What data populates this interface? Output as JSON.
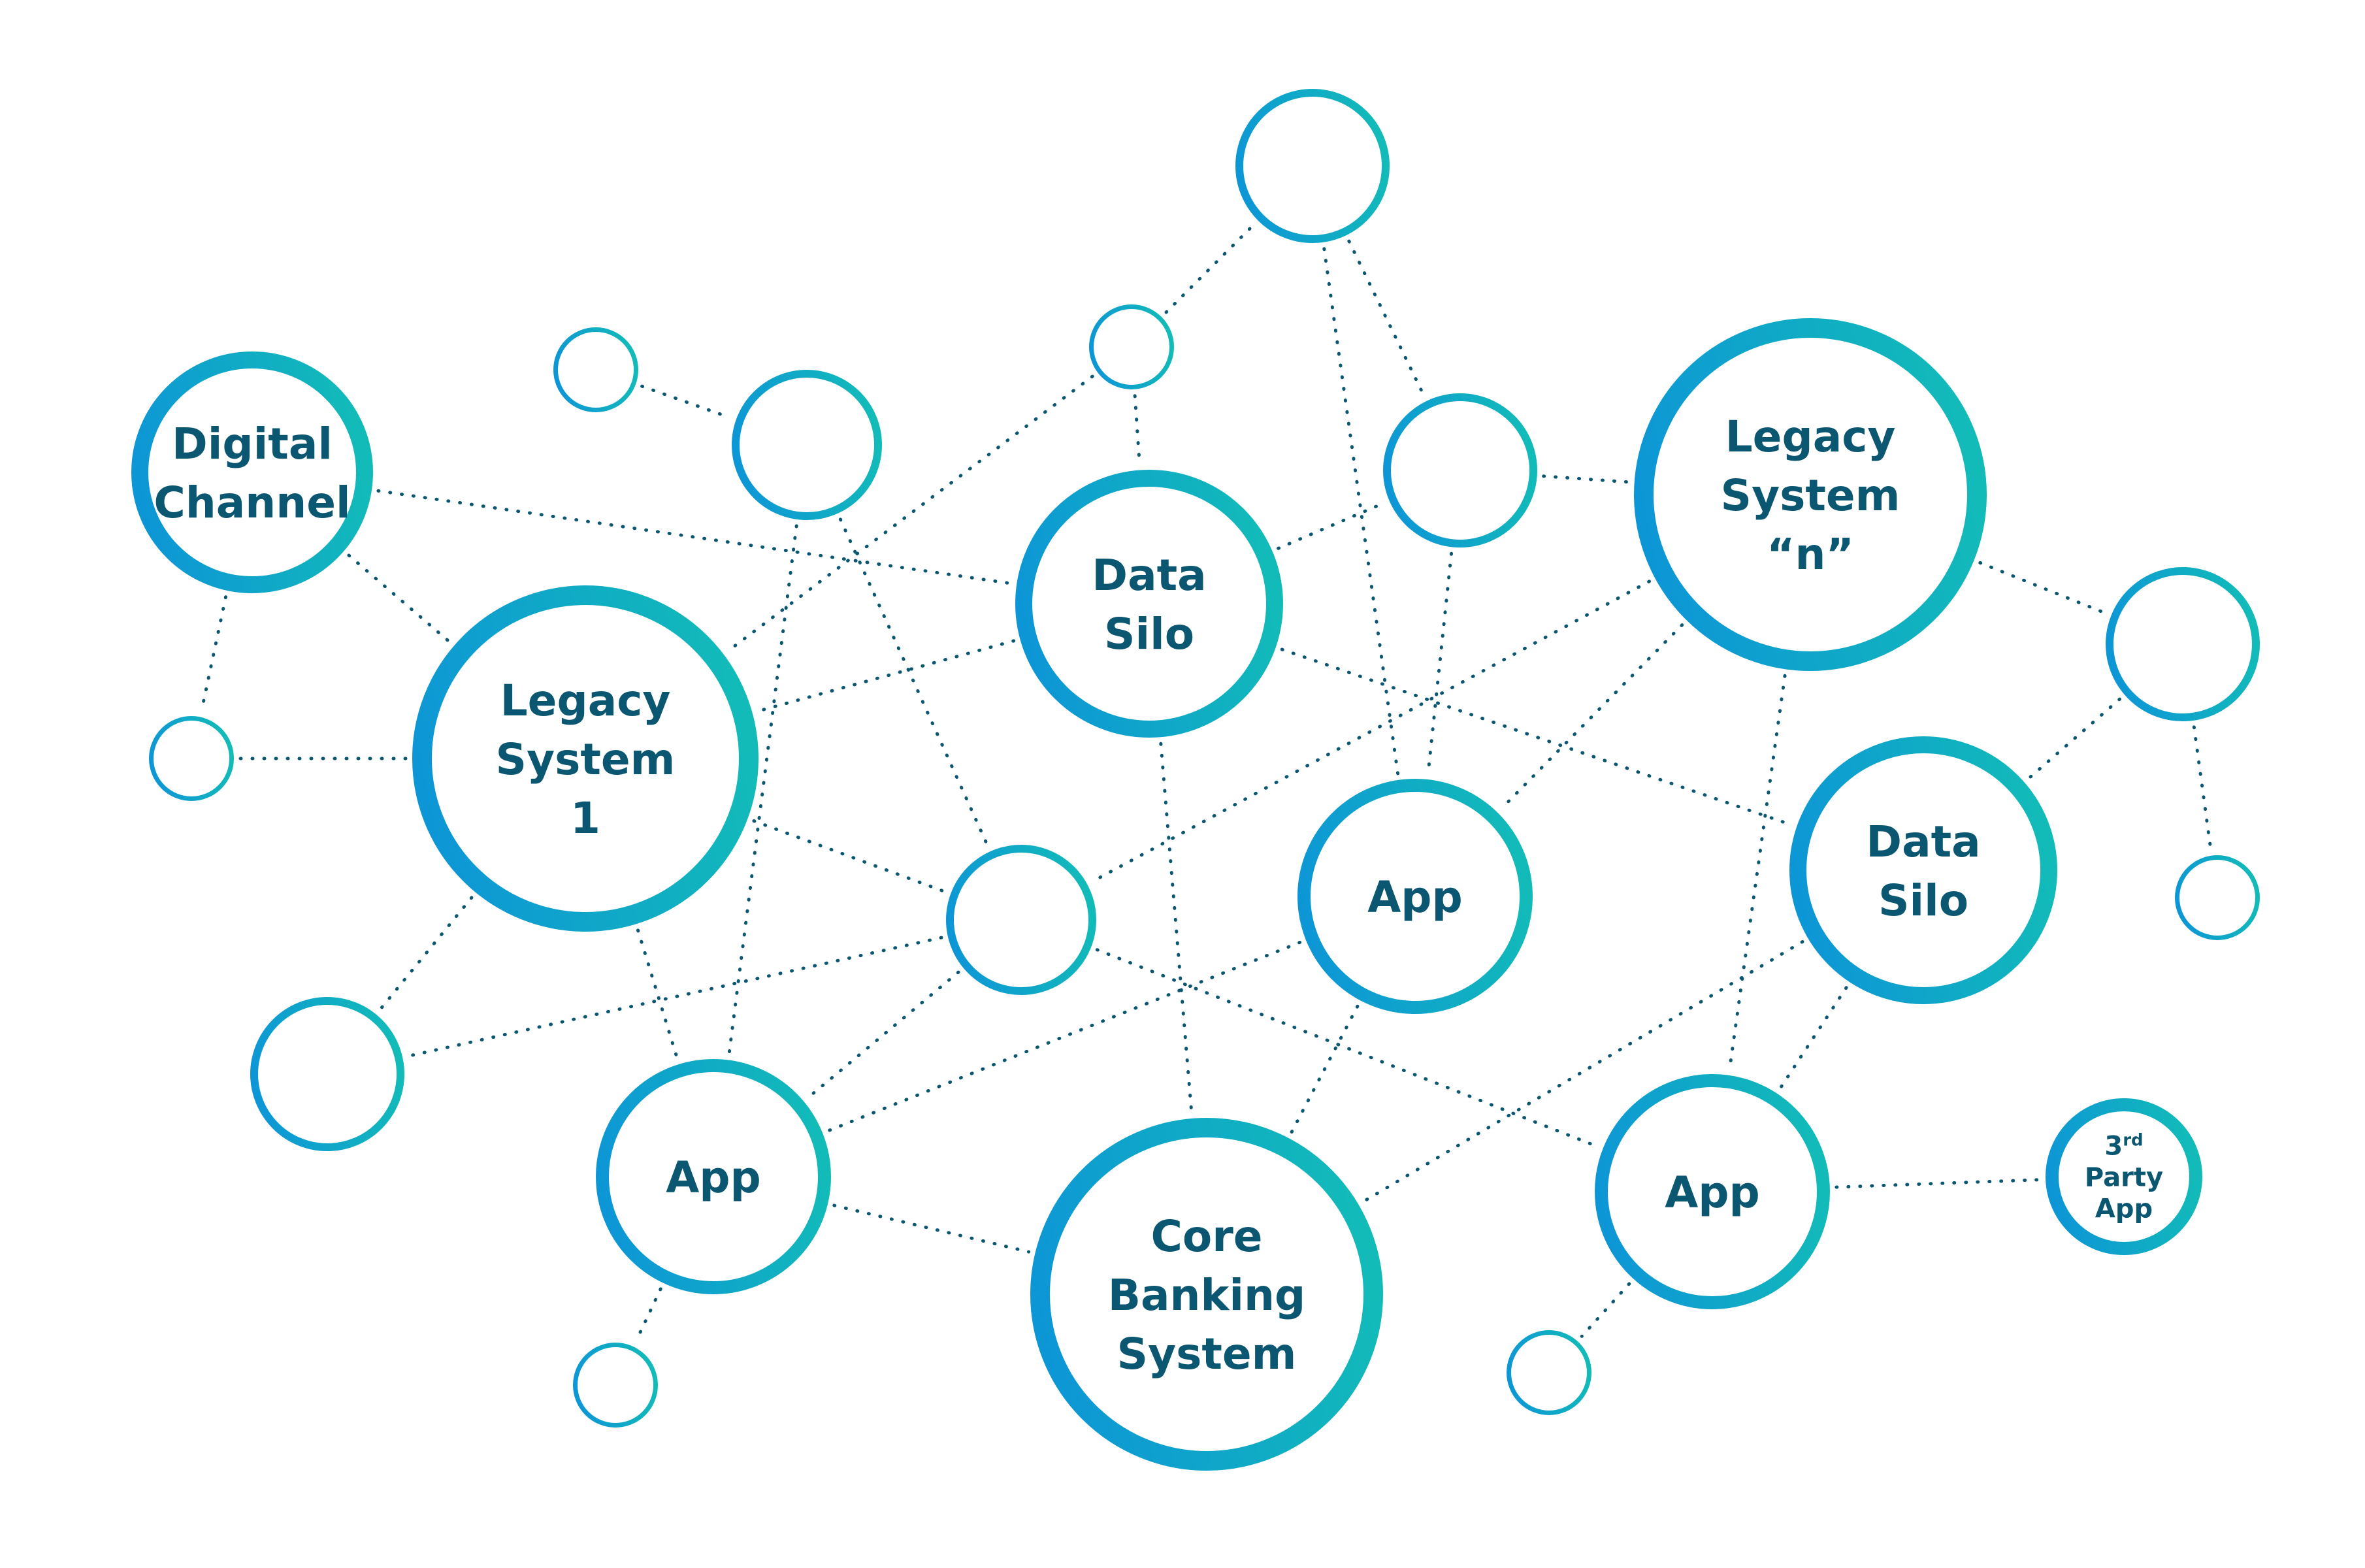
{
  "diagram": {
    "title": "",
    "colors": {
      "ring_start": "#0d96d6",
      "ring_end": "#12bbb8",
      "label": "#0b5670",
      "edge": "#0b5670",
      "background": "#ffffff"
    },
    "nodes": [
      {
        "id": "digital-channel",
        "label": [
          "Digital",
          "Channel"
        ],
        "size": "medium"
      },
      {
        "id": "empty-1",
        "label": [],
        "size": "tiny"
      },
      {
        "id": "empty-2",
        "label": [],
        "size": "small"
      },
      {
        "id": "empty-3",
        "label": [],
        "size": "tiny"
      },
      {
        "id": "empty-4",
        "label": [],
        "size": "small"
      },
      {
        "id": "data-silo-1",
        "label": [
          "Data",
          "Silo"
        ],
        "size": "medium"
      },
      {
        "id": "empty-5",
        "label": [],
        "size": "small"
      },
      {
        "id": "legacy-system-n",
        "label": [
          "Legacy",
          "System",
          "“n”"
        ],
        "size": "large"
      },
      {
        "id": "empty-6",
        "label": [],
        "size": "small"
      },
      {
        "id": "empty-7",
        "label": [],
        "size": "tiny"
      },
      {
        "id": "legacy-system-1",
        "label": [
          "Legacy",
          "System",
          "1"
        ],
        "size": "large"
      },
      {
        "id": "empty-8",
        "label": [],
        "size": "small"
      },
      {
        "id": "app-center",
        "label": [
          "App"
        ],
        "size": "medium"
      },
      {
        "id": "data-silo-2",
        "label": [
          "Data",
          "Silo"
        ],
        "size": "medium"
      },
      {
        "id": "empty-9",
        "label": [],
        "size": "tiny"
      },
      {
        "id": "empty-10",
        "label": [],
        "size": "small"
      },
      {
        "id": "app-left",
        "label": [
          "App"
        ],
        "size": "medium"
      },
      {
        "id": "core-banking-system",
        "label": [
          "Core",
          "Banking",
          "System"
        ],
        "size": "large"
      },
      {
        "id": "app-right",
        "label": [
          "App"
        ],
        "size": "medium"
      },
      {
        "id": "third-party-app",
        "label": [
          "3rd",
          "Party",
          "App"
        ],
        "size": "small-label"
      },
      {
        "id": "empty-11",
        "label": [],
        "size": "tiny"
      },
      {
        "id": "empty-12",
        "label": [],
        "size": "tiny"
      }
    ],
    "edges": [
      [
        "digital-channel",
        "legacy-system-1"
      ],
      [
        "digital-channel",
        "empty-7"
      ],
      [
        "digital-channel",
        "data-silo-1"
      ],
      [
        "empty-1",
        "empty-2"
      ],
      [
        "empty-2",
        "app-left"
      ],
      [
        "empty-2",
        "empty-8"
      ],
      [
        "empty-3",
        "empty-4"
      ],
      [
        "empty-3",
        "data-silo-1"
      ],
      [
        "empty-3",
        "legacy-system-1"
      ],
      [
        "empty-4",
        "app-center"
      ],
      [
        "empty-4",
        "empty-5"
      ],
      [
        "data-silo-1",
        "legacy-system-1"
      ],
      [
        "data-silo-1",
        "empty-5"
      ],
      [
        "data-silo-1",
        "data-silo-2"
      ],
      [
        "data-silo-1",
        "core-banking-system"
      ],
      [
        "empty-5",
        "legacy-system-n"
      ],
      [
        "empty-5",
        "app-center"
      ],
      [
        "legacy-system-n",
        "empty-6"
      ],
      [
        "legacy-system-n",
        "empty-8"
      ],
      [
        "legacy-system-n",
        "app-center"
      ],
      [
        "legacy-system-n",
        "app-right"
      ],
      [
        "empty-6",
        "data-silo-2"
      ],
      [
        "empty-6",
        "empty-9"
      ],
      [
        "empty-7",
        "legacy-system-1"
      ],
      [
        "legacy-system-1",
        "empty-8"
      ],
      [
        "legacy-system-1",
        "empty-10"
      ],
      [
        "legacy-system-1",
        "app-left"
      ],
      [
        "empty-8",
        "empty-10"
      ],
      [
        "empty-8",
        "app-left"
      ],
      [
        "empty-8",
        "app-right"
      ],
      [
        "app-center",
        "app-left"
      ],
      [
        "app-center",
        "core-banking-system"
      ],
      [
        "data-silo-2",
        "core-banking-system"
      ],
      [
        "data-silo-2",
        "app-right"
      ],
      [
        "app-left",
        "core-banking-system"
      ],
      [
        "app-left",
        "empty-11"
      ],
      [
        "app-right",
        "third-party-app"
      ],
      [
        "app-right",
        "empty-12"
      ]
    ]
  }
}
